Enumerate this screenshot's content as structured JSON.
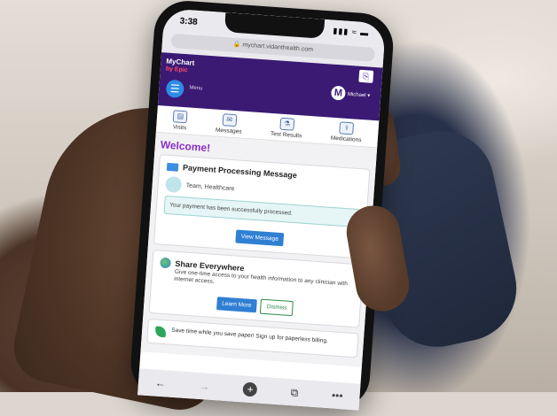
{
  "status": {
    "time": "3:38",
    "signal": "▮▮▮ ≈ ▬"
  },
  "browser": {
    "url": "mychart.vidanthealth.com",
    "lock": "🔒"
  },
  "app": {
    "logo_line1": "MyChart",
    "logo_line2": "by Epic",
    "menu_label": "Menu",
    "user_initial": "M",
    "user_name": "Michael ▾"
  },
  "tabs": [
    {
      "label": "Visits",
      "icon": "▤"
    },
    {
      "label": "Messages",
      "icon": "✉"
    },
    {
      "label": "Test Results",
      "icon": "⚗"
    },
    {
      "label": "Medications",
      "icon": "⚕"
    }
  ],
  "welcome": "Welcome!",
  "payment_card": {
    "title": "Payment Processing Message",
    "sender": "Team, Healthcare",
    "message": "Your payment has been successfully processed.",
    "button": "View Message"
  },
  "share_card": {
    "title": "Share Everywhere",
    "description": "Give one-time access to your health information to any clinician with internet access.",
    "learn_more": "Learn More",
    "dismiss": "Dismiss"
  },
  "paperless": {
    "text": "Save time while you save paper! Sign up for paperless billing."
  },
  "bottom_nav": {
    "back": "←",
    "forward": "→",
    "add": "+",
    "tabs": "⧉",
    "more": "•••"
  }
}
